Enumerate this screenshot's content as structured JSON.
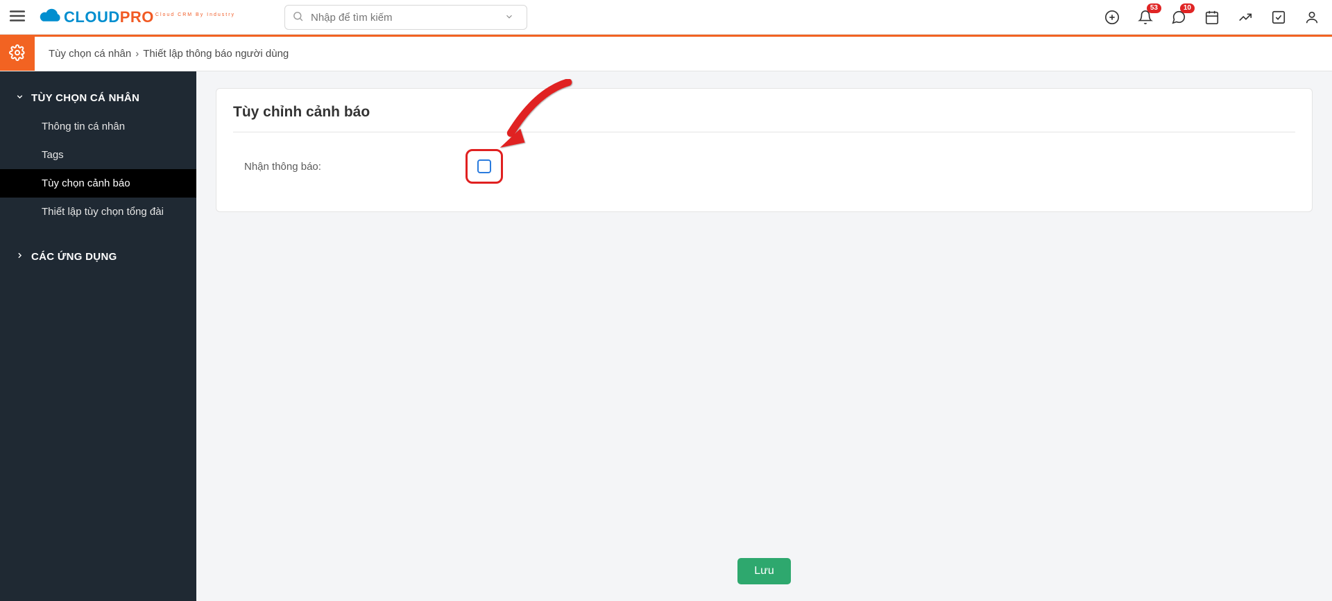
{
  "logo": {
    "part1": "CLOUD",
    "part2": "PRO",
    "subtitle": "Cloud CRM By Industry"
  },
  "search": {
    "placeholder": "Nhập để tìm kiếm"
  },
  "topbar": {
    "bell_badge": "53",
    "chat_badge": "10"
  },
  "breadcrumb": {
    "parent": "Tùy chọn cá nhân",
    "current": "Thiết lập thông báo người dùng"
  },
  "sidebar": {
    "group1": {
      "title": "TÙY CHỌN CÁ NHÂN",
      "items": [
        "Thông tin cá nhân",
        "Tags",
        "Tùy chọn cảnh báo",
        "Thiết lập tùy chọn tổng đài"
      ],
      "active_index": 2
    },
    "group2": {
      "title": "CÁC ỨNG DỤNG"
    }
  },
  "panel": {
    "title": "Tùy chỉnh cảnh báo",
    "field_label": "Nhận thông báo:"
  },
  "buttons": {
    "save": "Lưu"
  }
}
